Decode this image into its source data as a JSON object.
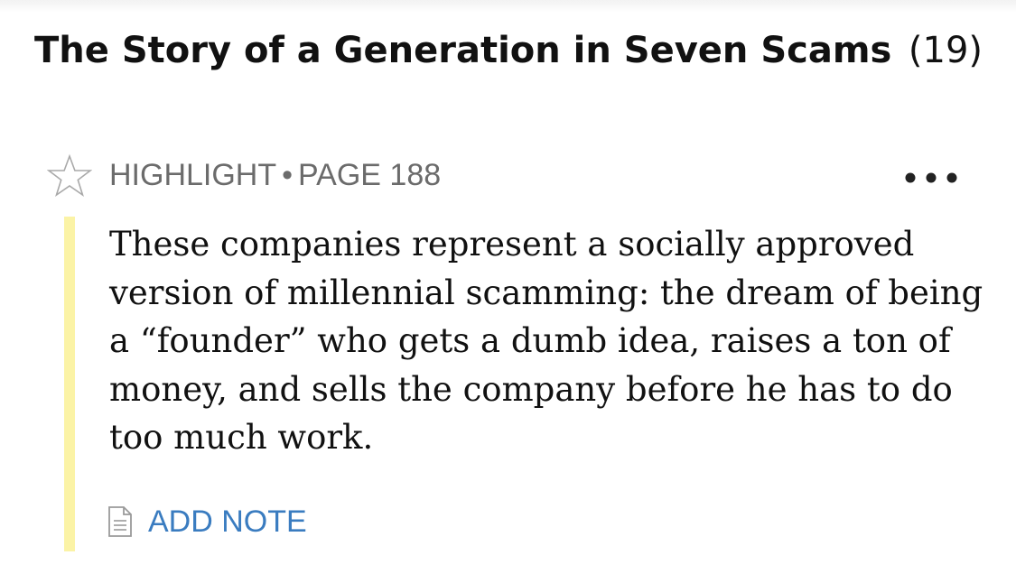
{
  "chapter": {
    "title": "The Story of a Generation in Seven Scams",
    "count": "(19)"
  },
  "highlight": {
    "type_label": "HIGHLIGHT",
    "separator": "•",
    "page_label": "PAGE 188",
    "text": "These companies represent a socially approved version of millennial scamming: the dream of being a “founder” who gets a dumb idea, raises a ton of money, and sells the company before he has to do too much work.",
    "bar_color": "#fbf3a6",
    "add_note_label": "ADD NOTE",
    "add_note_color": "#3a7cc0",
    "icons": {
      "star": "star-outline-icon",
      "more": "more-options-icon",
      "note": "note-document-icon"
    }
  }
}
